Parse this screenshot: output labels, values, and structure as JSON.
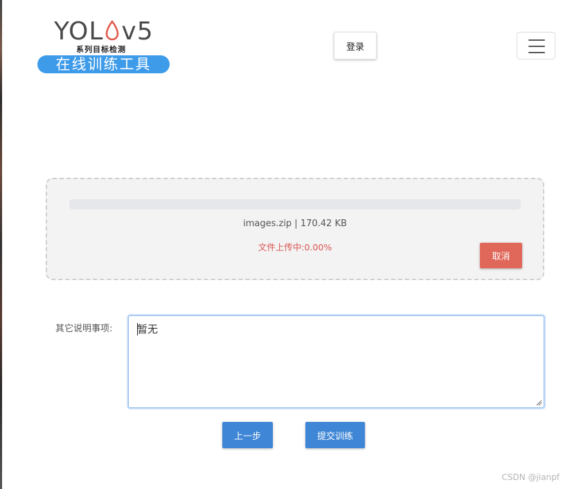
{
  "logo": {
    "word_prefix": "YOL",
    "word_suffix": "v5",
    "subtitle": "系列目标检测",
    "pill": "在线训练工具"
  },
  "header": {
    "login_label": "登录",
    "menu_icon": "hamburger-icon"
  },
  "upload": {
    "file_info": "images.zip | 170.42 KB",
    "status": "文件上传中:0.00%",
    "progress_percent": 0,
    "cancel_label": "取消"
  },
  "notes": {
    "label": "其它说明事项:",
    "value": "暂无"
  },
  "actions": {
    "prev_label": "上一步",
    "submit_label": "提交训练"
  },
  "watermark": "CSDN @jianpf",
  "colors": {
    "accent_blue": "#3d9be9",
    "button_blue": "#3f86d6",
    "danger": "#e0685a",
    "status_red": "#d9534f"
  }
}
